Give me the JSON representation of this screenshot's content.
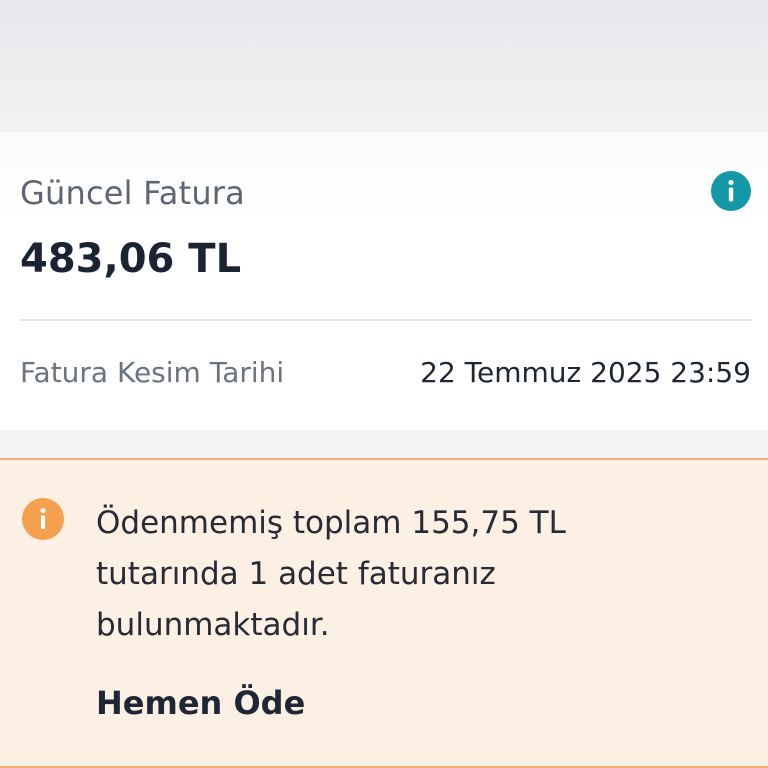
{
  "invoice": {
    "title": "Güncel Fatura",
    "amount": "483,06 TL",
    "cut_date_label": "Fatura Kesim Tarihi",
    "cut_date_value": "22 Temmuz 2025 23:59"
  },
  "warning": {
    "message": "Ödenmemiş toplam 155,75 TL tutarında 1 adet faturanız bulunmaktadır.",
    "pay_action": "Hemen Öde"
  },
  "icons": {
    "info": "info-icon",
    "warning": "info-icon"
  },
  "colors": {
    "info_teal": "#1497a7",
    "warning_orange": "#f4a04f",
    "warning_bg": "#fcefe3",
    "warning_border": "#f0b077"
  }
}
